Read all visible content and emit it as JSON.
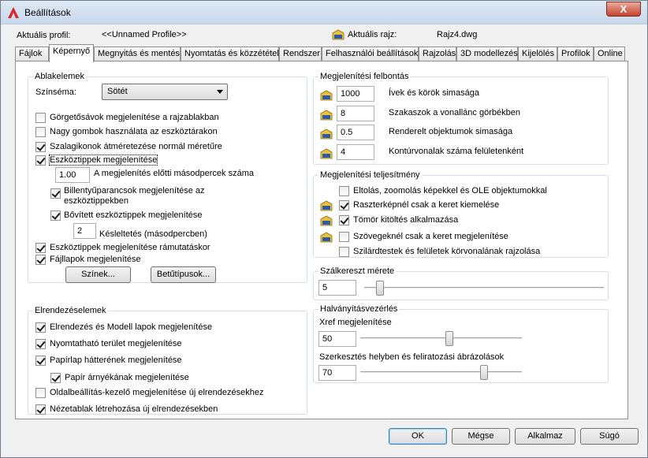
{
  "window": {
    "title": "Beállítások",
    "close_label": "X"
  },
  "header": {
    "profile_label": "Aktuális profil:",
    "profile_value": "<<Unnamed Profile>>",
    "drawing_label": "Aktuális rajz:",
    "drawing_value": "Rajz4.dwg"
  },
  "tabs": [
    "Fájlok",
    "Képernyő",
    "Megnyitás és mentés",
    "Nyomtatás és közzététel",
    "Rendszer",
    "Felhasználói beállítások",
    "Rajzolás",
    "3D modellezés",
    "Kijelölés",
    "Profilok",
    "Online"
  ],
  "active_tab": "Képernyő",
  "window_elements": {
    "title": "Ablakelemek",
    "color_scheme_label": "Színséma:",
    "color_scheme_value": "Sötét",
    "scrollbars": "Görgetősávok megjelenítése a rajzablakban",
    "large_buttons": "Nagy gombok használata az eszköztárakon",
    "resize_ribbon": "Szalagikonok átméretezése normál méretűre",
    "tooltips": "Eszköztippek megjelenítése",
    "tooltip_delay_value": "1.00",
    "tooltip_delay_label": "A megjelenítés előtti másodpercek száma",
    "shortcut_keys": "Billentyűparancsok megjelenítése az eszköztippekben",
    "extended_tooltips": "Bővített eszköztippek megjelenítése",
    "ext_delay_value": "2",
    "ext_delay_label": "Késleltetés (másodpercben)",
    "rollover_tooltips": "Eszköztippek megjelenítése rámutatáskor",
    "file_tabs": "Fájllapok megjelenítése",
    "colors_button": "Színek...",
    "fonts_button": "Betűtípusok..."
  },
  "layout_elements": {
    "title": "Elrendezéselemek",
    "layout_model_tabs": "Elrendezés és Modell lapok megjelenítése",
    "printable_area": "Nyomtatható terület megjelenítése",
    "paper_background": "Papírlap hátterének megjelenítése",
    "paper_shadow": "Papír árnyékának megjelenítése",
    "page_setup_manager": "Oldalbeállítás-kezelő megjelenítése új elrendezésekhez",
    "create_viewports": "Nézetablak létrehozása új elrendezésekben"
  },
  "resolution": {
    "title": "Megjelenítési felbontás",
    "arc_value": "1000",
    "arc_label": "Ívek és körök simasága",
    "polyline_value": "8",
    "polyline_label": "Szakaszok a vonallánc görbékben",
    "rendered_value": "0.5",
    "rendered_label": "Renderelt objektumok simasága",
    "contour_value": "4",
    "contour_label": "Kontúrvonalak száma felületenként"
  },
  "performance": {
    "title": "Megjelenítési teljesítmény",
    "pan_zoom": "Eltolás, zoomolás képekkel és OLE objektumokkal",
    "raster_frame": "Raszterképnél csak a keret kiemelése",
    "solid_fill": "Tömör kitöltés alkalmazása",
    "text_frame": "Szövegeknél csak a keret megjelenítése",
    "silhouettes": "Szilárdtestek és felületek körvonalának rajzolása"
  },
  "crosshair": {
    "title": "Szálkereszt mérete",
    "value": "5",
    "level": 5
  },
  "fade": {
    "title": "Halványításvezérlés",
    "xref_label": "Xref megjelenítése",
    "xref_value": "50",
    "inplace_label": "Szerkesztés helyben és feliratozási ábrázolások",
    "inplace_value": "70"
  },
  "buttons": {
    "ok": "OK",
    "cancel": "Mégse",
    "apply": "Alkalmaz",
    "help": "Súgó"
  },
  "colors": {
    "accent": "#3c7fb1",
    "close": "#c7432d"
  }
}
